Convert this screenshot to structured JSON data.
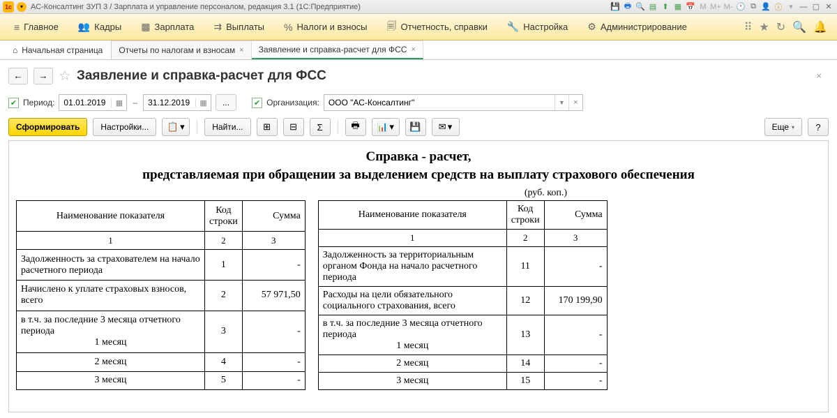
{
  "titlebar": {
    "logo": "1c",
    "text": "АС-Консалтинг ЗУП 3 / Зарплата и управление персоналом, редакция 3.1  (1С:Предприятие)"
  },
  "mainmenu": {
    "items": [
      {
        "icon": "≡",
        "label": "Главное"
      },
      {
        "icon": "👥",
        "label": "Кадры"
      },
      {
        "icon": "▦",
        "label": "Зарплата"
      },
      {
        "icon": "⇉",
        "label": "Выплаты"
      },
      {
        "icon": "%",
        "label": "Налоги и взносы"
      },
      {
        "icon": "🗐",
        "label": "Отчетность, справки"
      },
      {
        "icon": "🔧",
        "label": "Настройка"
      },
      {
        "icon": "⚙",
        "label": "Администрирование"
      }
    ]
  },
  "tabs": {
    "home_icon": "⌂",
    "home_label": "Начальная страница",
    "items": [
      {
        "label": "Отчеты по налогам и взносам",
        "active": false
      },
      {
        "label": "Заявление и справка-расчет для ФСС",
        "active": true
      }
    ]
  },
  "page": {
    "title": "Заявление и справка-расчет для ФСС"
  },
  "params": {
    "period_label": "Период:",
    "date_from": "01.01.2019",
    "date_to": "31.12.2019",
    "org_label": "Организация:",
    "org_value": "ООО \"АС-Консалтинг\""
  },
  "toolbar": {
    "form": "Сформировать",
    "settings": "Настройки...",
    "find": "Найти...",
    "more": "Еще",
    "help": "?"
  },
  "report": {
    "title": "Справка - расчет,\nпредставляемая при обращении за выделением средств на выплату страхового обеспечения",
    "currency": "(руб. коп.)",
    "headers": {
      "name": "Наименование показателя",
      "code": "Код строки",
      "sum": "Сумма"
    },
    "numrow": {
      "c1": "1",
      "c2": "2",
      "c3": "3"
    },
    "left_rows": [
      {
        "name": "Задолженность за страхователем на начало расчетного периода",
        "code": "1",
        "sum": "-"
      },
      {
        "name": "Начислено к уплате страховых взносов, всего",
        "code": "2",
        "sum": "57 971,50"
      },
      {
        "name": "в т.ч. за последние 3 месяца отчетного периода",
        "sub": "1 месяц",
        "code": "3",
        "sum": "-"
      },
      {
        "name": "2 месяц",
        "indent": true,
        "code": "4",
        "sum": "-"
      },
      {
        "name": "3 месяц",
        "indent": true,
        "code": "5",
        "sum": "-"
      }
    ],
    "right_rows": [
      {
        "name": "Задолженность за территориальным органом Фонда на  начало расчетного периода",
        "code": "11",
        "sum": "-"
      },
      {
        "name": "Расходы на цели обязательного социального страхования, всего",
        "code": "12",
        "sum": "170 199,90"
      },
      {
        "name": "в т.ч. за последние 3 месяца отчетного периода",
        "sub": "1 месяц",
        "code": "13",
        "sum": "-"
      },
      {
        "name": "2 месяц",
        "indent": true,
        "code": "14",
        "sum": "-"
      },
      {
        "name": "3 месяц",
        "indent": true,
        "code": "15",
        "sum": "-"
      }
    ]
  }
}
